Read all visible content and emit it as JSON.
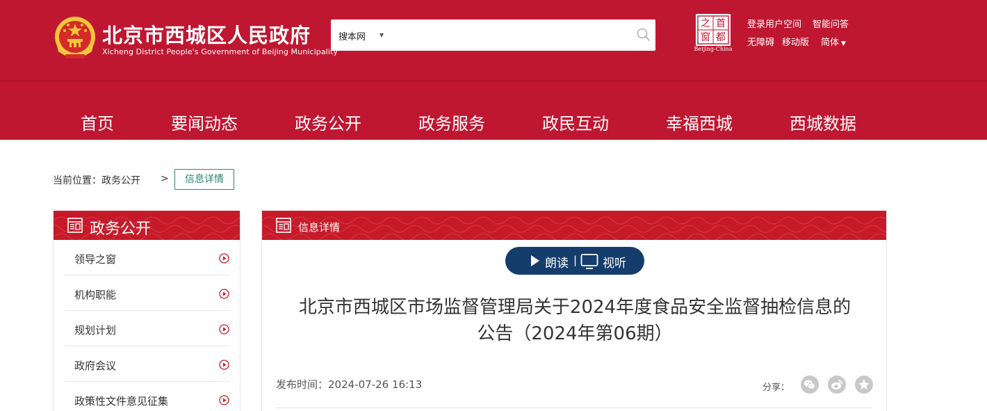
{
  "header": {
    "title": "北京市西城区人民政府",
    "subtitle": "Xicheng District People's Government of Beijing Municipality",
    "search": {
      "scope": "搜本网",
      "placeholder": ""
    },
    "capital_badge": {
      "chars": [
        "之",
        "首",
        "窗",
        "都"
      ],
      "caption": "Beijing-China"
    },
    "links": [
      "登录用户空间",
      "智能问答",
      "无障碍",
      "移动版",
      "简体"
    ],
    "brand_color": "#bf1731"
  },
  "nav": [
    "首页",
    "要闻动态",
    "政务公开",
    "政务服务",
    "政民互动",
    "幸福西城",
    "西城数据"
  ],
  "breadcrumb": {
    "prefix": "当前位置：",
    "section": "政务公开",
    "separator": ">",
    "current": "信息详情"
  },
  "sidebar": {
    "title": "政务公开",
    "items": [
      "领导之窗",
      "机构职能",
      "规划计划",
      "政府会议",
      "政策性文件意见征集"
    ]
  },
  "content": {
    "panel_title": "信息详情",
    "read_label": "朗读",
    "read_separator": "|",
    "watch_label": "视听",
    "title_line1": "北京市西城区市场监督管理局关于2024年度食品安全监督抽检信息的",
    "title_line2": "公告（2024年第06期）",
    "publish_time": "发布时间：2024-07-26 16:13",
    "share_label": "分享：",
    "share_icons": [
      "wechat-icon",
      "weibo-icon",
      "favorite-icon"
    ]
  },
  "icons": {
    "search": "search-icon",
    "panel": "document-icon",
    "list_arrow": "circle-play-icon"
  }
}
